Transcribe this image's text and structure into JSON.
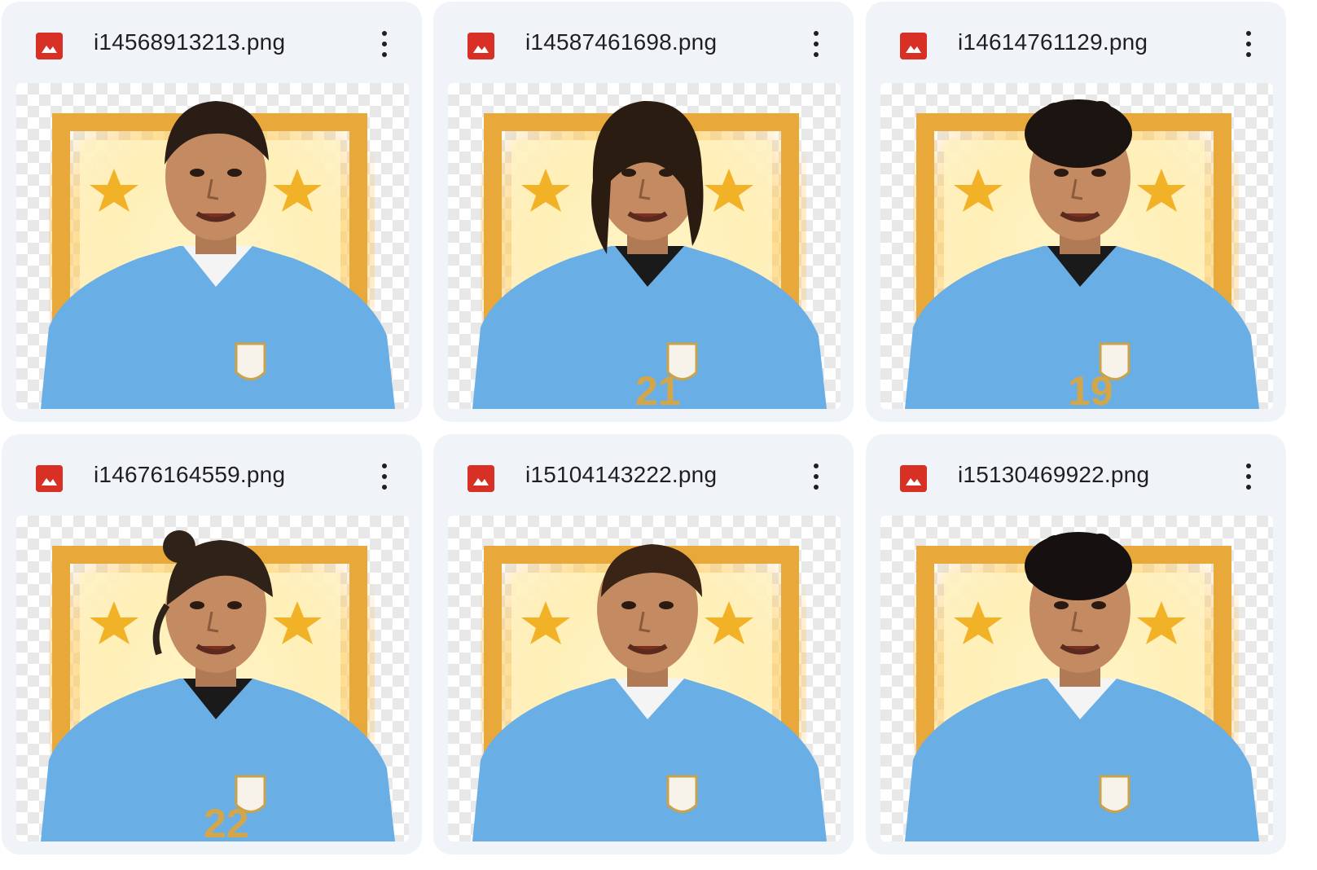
{
  "files": [
    {
      "name": "i14568913213.png",
      "icon": "image-file-icon",
      "hair": "#2a1d16",
      "hair_style": "slick",
      "collar": "white",
      "number": ""
    },
    {
      "name": "i14587461698.png",
      "icon": "image-file-icon",
      "hair": "#2b1c12",
      "hair_style": "long",
      "collar": "black",
      "number": "21"
    },
    {
      "name": "i14614761129.png",
      "icon": "image-file-icon",
      "hair": "#1c1410",
      "hair_style": "curly",
      "collar": "black",
      "number": "19"
    },
    {
      "name": "i14676164559.png",
      "icon": "image-file-icon",
      "hair": "#2e2219",
      "hair_style": "bun",
      "collar": "black",
      "number": "22"
    },
    {
      "name": "i15104143222.png",
      "icon": "image-file-icon",
      "hair": "#3a2416",
      "hair_style": "short",
      "collar": "white",
      "number": ""
    },
    {
      "name": "i15130469922.png",
      "icon": "image-file-icon",
      "hair": "#161010",
      "hair_style": "curly",
      "collar": "white",
      "number": ""
    }
  ],
  "colors": {
    "card_bg": "#f0f4f9",
    "file_icon": "#d93025",
    "jersey": "#6aaee6",
    "frame_gold": "#e9a93a",
    "star": "#f2b227"
  },
  "more_icon": "more-vert-icon"
}
